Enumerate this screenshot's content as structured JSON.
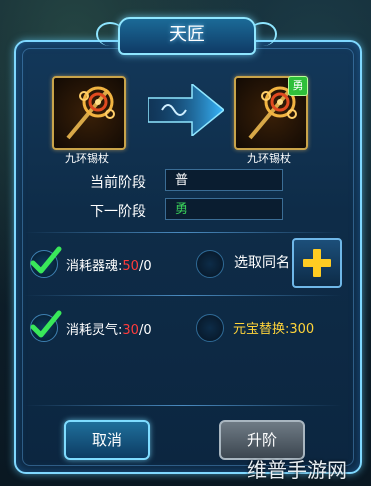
{
  "window": {
    "title": "天匠"
  },
  "items": {
    "source_name": "九环锡杖",
    "target_name": "九环锡杖",
    "target_badge": "勇"
  },
  "stage": {
    "current_label": "当前阶段",
    "current_value": "普",
    "next_label": "下一阶段",
    "next_value": "勇"
  },
  "costs": {
    "soul_label": "消耗器魂:",
    "soul_have": "50",
    "soul_need": "/0",
    "select_same": "选取同名",
    "spirit_label": "消耗灵气:",
    "spirit_have": "30",
    "spirit_need": "/0",
    "yuanbao": "元宝替换:300"
  },
  "buttons": {
    "cancel": "取消",
    "upgrade": "升阶"
  },
  "watermark": "维普手游网",
  "colors": {
    "accent": "#7fd8ff",
    "gold": "#ffd43a",
    "red": "#ff3c3c",
    "green": "#39d05a"
  }
}
